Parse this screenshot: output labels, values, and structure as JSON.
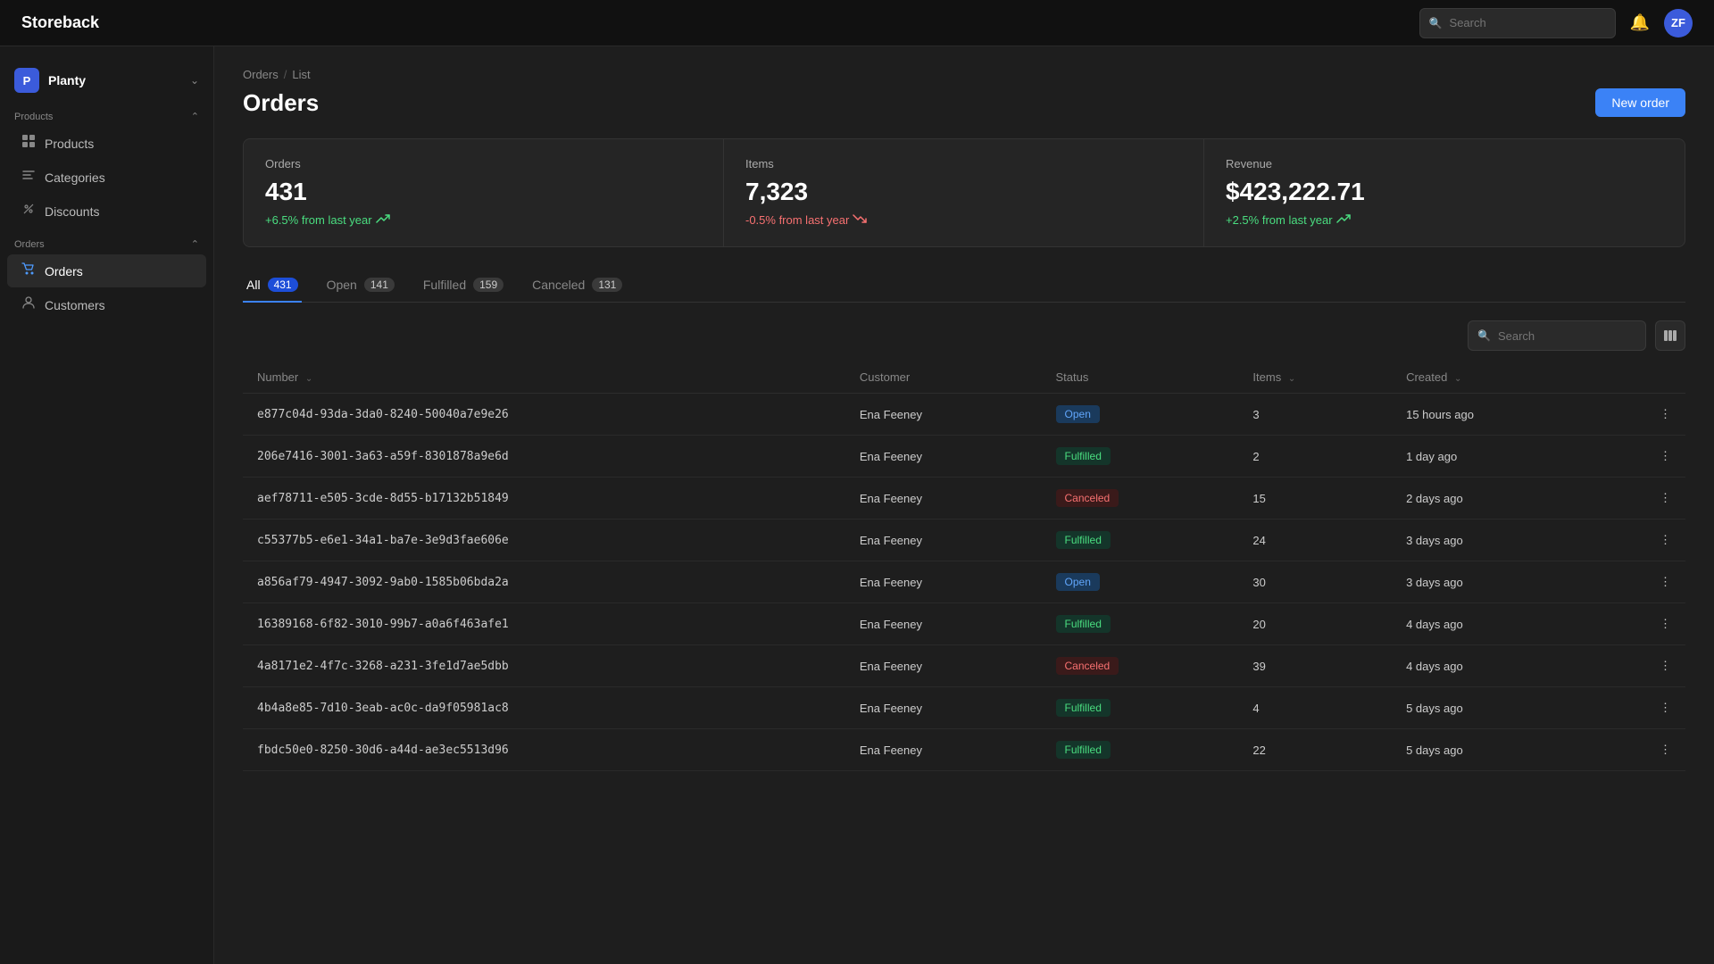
{
  "app": {
    "brand": "Storeback",
    "avatar_initials": "ZF",
    "search_placeholder": "Search"
  },
  "sidebar": {
    "workspace_initial": "P",
    "workspace_name": "Planty",
    "sections": [
      {
        "label": "Products",
        "expanded": true,
        "items": [
          {
            "id": "products",
            "label": "Products",
            "icon": "🏷"
          },
          {
            "id": "categories",
            "label": "Categories",
            "icon": "🔖"
          },
          {
            "id": "discounts",
            "label": "Discounts",
            "icon": "🏷"
          }
        ]
      },
      {
        "label": "Orders",
        "expanded": true,
        "items": [
          {
            "id": "orders",
            "label": "Orders",
            "icon": "🛒",
            "active": true
          },
          {
            "id": "customers",
            "label": "Customers",
            "icon": "👤"
          }
        ]
      }
    ]
  },
  "breadcrumb": {
    "items": [
      "Orders",
      "List"
    ]
  },
  "page": {
    "title": "Orders",
    "new_button": "New order"
  },
  "stats": [
    {
      "id": "orders",
      "label": "Orders",
      "value": "431",
      "change": "+6.5% from last year",
      "positive": true
    },
    {
      "id": "items",
      "label": "Items",
      "value": "7,323",
      "change": "-0.5% from last year",
      "positive": false
    },
    {
      "id": "revenue",
      "label": "Revenue",
      "value": "$423,222.71",
      "change": "+2.5% from last year",
      "positive": true
    }
  ],
  "tabs": [
    {
      "id": "all",
      "label": "All",
      "count": "431",
      "active": true
    },
    {
      "id": "open",
      "label": "Open",
      "count": "141",
      "active": false
    },
    {
      "id": "fulfilled",
      "label": "Fulfilled",
      "count": "159",
      "active": false
    },
    {
      "id": "canceled",
      "label": "Canceled",
      "count": "131",
      "active": false
    }
  ],
  "table": {
    "search_placeholder": "Search",
    "columns": [
      "Number",
      "Customer",
      "Status",
      "Items",
      "Created"
    ],
    "rows": [
      {
        "id": "e877c04d-93da-3da0-8240-50040a7e9e26",
        "customer": "Ena Feeney",
        "status": "Open",
        "items": 3,
        "created": "15 hours ago"
      },
      {
        "id": "206e7416-3001-3a63-a59f-8301878a9e6d",
        "customer": "Ena Feeney",
        "status": "Fulfilled",
        "items": 2,
        "created": "1 day ago"
      },
      {
        "id": "aef78711-e505-3cde-8d55-b17132b51849",
        "customer": "Ena Feeney",
        "status": "Canceled",
        "items": 15,
        "created": "2 days ago"
      },
      {
        "id": "c55377b5-e6e1-34a1-ba7e-3e9d3fae606e",
        "customer": "Ena Feeney",
        "status": "Fulfilled",
        "items": 24,
        "created": "3 days ago"
      },
      {
        "id": "a856af79-4947-3092-9ab0-1585b06bda2a",
        "customer": "Ena Feeney",
        "status": "Open",
        "items": 30,
        "created": "3 days ago"
      },
      {
        "id": "16389168-6f82-3010-99b7-a0a6f463afe1",
        "customer": "Ena Feeney",
        "status": "Fulfilled",
        "items": 20,
        "created": "4 days ago"
      },
      {
        "id": "4a8171e2-4f7c-3268-a231-3fe1d7ae5dbb",
        "customer": "Ena Feeney",
        "status": "Canceled",
        "items": 39,
        "created": "4 days ago"
      },
      {
        "id": "4b4a8e85-7d10-3eab-ac0c-da9f05981ac8",
        "customer": "Ena Feeney",
        "status": "Fulfilled",
        "items": 4,
        "created": "5 days ago"
      },
      {
        "id": "fbdc50e0-8250-30d6-a44d-ae3ec5513d96",
        "customer": "Ena Feeney",
        "status": "Fulfilled",
        "items": 22,
        "created": "5 days ago"
      }
    ]
  }
}
